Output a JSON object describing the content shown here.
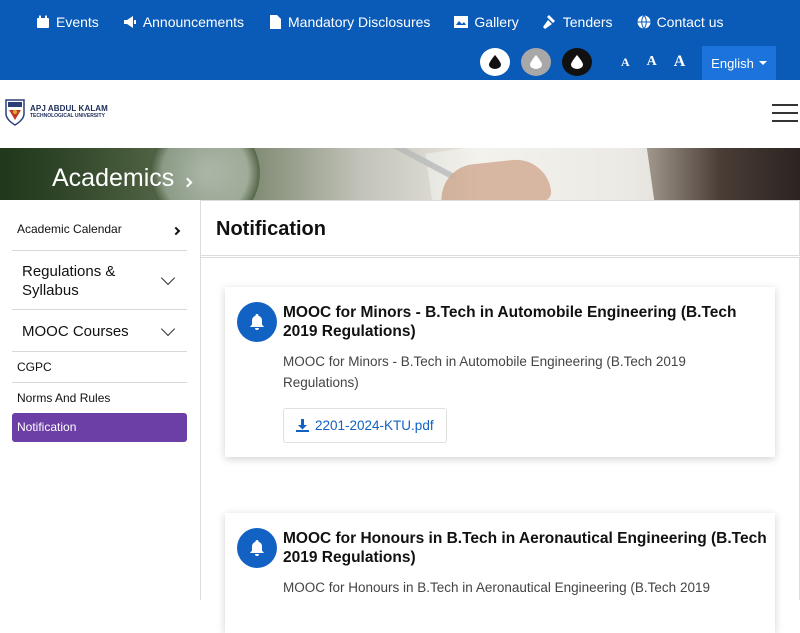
{
  "topnav": {
    "items": [
      {
        "label": "Events",
        "icon": "calendar-icon"
      },
      {
        "label": "Announcements",
        "icon": "megaphone-icon"
      },
      {
        "label": "Mandatory Disclosures",
        "icon": "document-icon"
      },
      {
        "label": "Gallery",
        "icon": "image-icon"
      },
      {
        "label": "Tenders",
        "icon": "gavel-icon"
      },
      {
        "label": "Contact us",
        "icon": "globe-icon"
      }
    ],
    "font_sizes": [
      "A",
      "A",
      "A"
    ],
    "language": "English",
    "accent_color": "#0a5ab8"
  },
  "header": {
    "logo_line1": "APJ ABDUL KALAM",
    "logo_line2": "TECHNOLOGICAL UNIVERSITY",
    "logo_line3": "",
    "menu_icon": "hamburger-icon"
  },
  "banner": {
    "title": "Academics"
  },
  "sidebar": {
    "items": [
      {
        "label": "Academic Calendar"
      },
      {
        "label": "Regulations & Syllabus"
      },
      {
        "label": "MOOC Courses"
      },
      {
        "label": "CGPC"
      },
      {
        "label": "Norms And Rules"
      },
      {
        "label": "Notification"
      }
    ],
    "active_color": "#6b3fa6"
  },
  "main": {
    "title": "Notification",
    "notifications": [
      {
        "title": "MOOC for Minors - B.Tech in Automobile Engineering (B.Tech 2019 Regulations)",
        "description": "MOOC for Minors - B.Tech in Automobile Engineering (B.Tech 2019 Regulations)",
        "file": "2201-2024-KTU.pdf"
      },
      {
        "title": "MOOC for Honours in B.Tech in Aeronautical Engineering (B.Tech 2019 Regulations)",
        "description": "MOOC for Honours in B.Tech in Aeronautical Engineering (B.Tech 2019"
      }
    ]
  }
}
